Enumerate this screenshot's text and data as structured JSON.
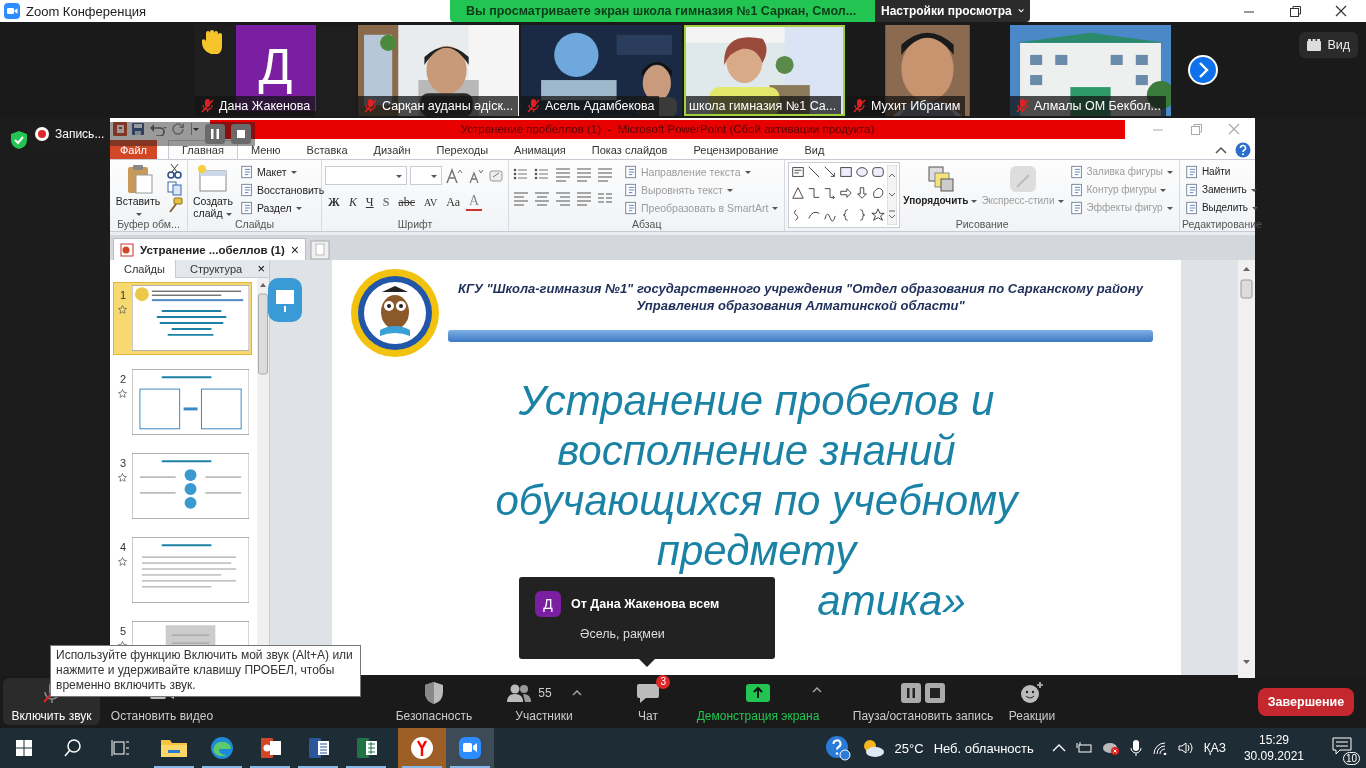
{
  "window": {
    "title": "Zoom Конференция"
  },
  "share_banner": {
    "text": "Вы просматриваете экран школа гимназия №1 Саркан, Смол..."
  },
  "view_options": {
    "label": "Настройки просмотра"
  },
  "participants": [
    {
      "name": "Дана Жакенова",
      "kind": "avatar",
      "initial": "Д",
      "muted": true,
      "hand_raised": true,
      "speaking": false
    },
    {
      "name": "Сарқан ауданы әдіск...",
      "kind": "picture",
      "muted": true,
      "hand_raised": false,
      "speaking": false
    },
    {
      "name": "Асель Адамбекова",
      "kind": "picture",
      "muted": true,
      "hand_raised": false,
      "speaking": false
    },
    {
      "name": "школа гимназия №1 Са...",
      "kind": "picture",
      "muted": false,
      "hand_raised": false,
      "speaking": true
    },
    {
      "name": "Мухит Ибрагим",
      "kind": "picture",
      "muted": true,
      "hand_raised": false,
      "speaking": false
    },
    {
      "name": "Алмалы ОМ Бекбол...",
      "kind": "picture",
      "muted": true,
      "hand_raised": false,
      "speaking": false
    }
  ],
  "view_button": {
    "label": "Вид"
  },
  "recording": {
    "label": "Запись..."
  },
  "powerpoint": {
    "title": "Устранение пробеллов (1)  -  Microsoft PowerPoint (Сбой активации продукта)",
    "tabs": [
      {
        "label": "Файл",
        "kind": "file",
        "selected": false
      },
      {
        "label": "Главная",
        "kind": "tab",
        "selected": true
      },
      {
        "label": "Меню",
        "kind": "tab",
        "selected": false
      },
      {
        "label": "Вставка",
        "kind": "tab",
        "selected": false
      },
      {
        "label": "Дизайн",
        "kind": "tab",
        "selected": false
      },
      {
        "label": "Переходы",
        "kind": "tab",
        "selected": false
      },
      {
        "label": "Анимация",
        "kind": "tab",
        "selected": false
      },
      {
        "label": "Показ слайдов",
        "kind": "tab",
        "selected": false
      },
      {
        "label": "Рецензирование",
        "kind": "tab",
        "selected": false
      },
      {
        "label": "Вид",
        "kind": "tab",
        "selected": false
      }
    ],
    "ribbon": [
      {
        "kind": "clipboard",
        "label": "Буфер обм...",
        "items": [
          {
            "kind": "large",
            "label": "Вставить",
            "dropdown": true,
            "disabled": false
          }
        ]
      },
      {
        "kind": "slides",
        "label": "Слайды",
        "items": [
          {
            "kind": "large",
            "label": "Создать слайд",
            "dropdown": true,
            "disabled": false
          },
          {
            "kind": "small",
            "label": "Макет",
            "dropdown": true,
            "disabled": false
          },
          {
            "kind": "small",
            "label": "Восстановить",
            "dropdown": false,
            "disabled": false
          },
          {
            "kind": "small",
            "label": "Раздел",
            "dropdown": true,
            "disabled": false
          }
        ]
      },
      {
        "kind": "font",
        "label": "Шрифт",
        "items": [
          {
            "kind": "bold",
            "label": "Ж"
          },
          {
            "kind": "italic",
            "label": "К"
          },
          {
            "kind": "underline",
            "label": "Ч"
          },
          {
            "kind": "shadow",
            "label": "S"
          },
          {
            "kind": "strike",
            "label": "abc"
          },
          {
            "kind": "spacing",
            "label": "AV"
          },
          {
            "kind": "case",
            "label": "Аа"
          },
          {
            "kind": "color",
            "label": "A"
          }
        ]
      },
      {
        "kind": "paragraph",
        "label": "Абзац",
        "items": [
          {
            "kind": "small",
            "label": "Направление текста",
            "dropdown": true,
            "disabled": true
          },
          {
            "kind": "small",
            "label": "Выровнять текст",
            "dropdown": true,
            "disabled": true
          },
          {
            "kind": "small",
            "label": "Преобразовать в SmartArt",
            "dropdown": true,
            "disabled": true
          }
        ]
      },
      {
        "kind": "drawing",
        "label": "Рисование",
        "items": [
          {
            "kind": "large",
            "label": "Упорядочить",
            "dropdown": true,
            "disabled": false
          },
          {
            "kind": "large",
            "label": "Экспресс-стили",
            "dropdown": true,
            "disabled": true
          },
          {
            "kind": "small",
            "label": "Заливка фигуры",
            "dropdown": true,
            "disabled": true
          },
          {
            "kind": "small",
            "label": "Контур фигуры",
            "dropdown": true,
            "disabled": true
          },
          {
            "kind": "small",
            "label": "Эффекты фигур",
            "dropdown": true,
            "disabled": true
          }
        ]
      },
      {
        "kind": "editing",
        "label": "Редактирование",
        "items": [
          {
            "kind": "small",
            "label": "Найти",
            "dropdown": false,
            "disabled": false
          },
          {
            "kind": "small",
            "label": "Заменить",
            "dropdown": true,
            "disabled": false
          },
          {
            "kind": "small",
            "label": "Выделить",
            "dropdown": true,
            "disabled": false
          }
        ]
      }
    ],
    "document_tab": {
      "label": "Устранение ...обеллов (1)",
      "close": "×"
    },
    "panel": {
      "tabs": [
        {
          "label": "Слайды",
          "selected": true
        },
        {
          "label": "Структура",
          "selected": false
        }
      ],
      "close": "×"
    },
    "slides": [
      {
        "number": "1",
        "selected": true
      },
      {
        "number": "2",
        "selected": false
      },
      {
        "number": "3",
        "selected": false
      },
      {
        "number": "4",
        "selected": false
      },
      {
        "number": "5",
        "selected": false
      }
    ],
    "slide": {
      "header_lines": [
        "КГУ \"Школа-гимназия №1\" государственного учреждения \"Отдел образования по Сарканскому району",
        "Управления образования Алматинской области\""
      ],
      "title_lines": [
        "Устранение пробелов и",
        "восполнение знаний",
        "обучающихся по учебному",
        "предмету",
        "атика»"
      ]
    }
  },
  "toolbar": [
    {
      "kind": "audio",
      "label": "Включить звук",
      "muted": true
    },
    {
      "kind": "video",
      "label": "Остановить видео"
    },
    {
      "kind": "security",
      "label": "Безопасность"
    },
    {
      "kind": "participants",
      "label": "Участники",
      "count": "55"
    },
    {
      "kind": "chat",
      "label": "Чат",
      "badge": "3"
    },
    {
      "kind": "share",
      "label": "Демонстрация экрана"
    },
    {
      "kind": "record",
      "label": "Пауза/остановить запись"
    },
    {
      "kind": "reactions",
      "label": "Реакции"
    }
  ],
  "end_button": {
    "label": "Завершение"
  },
  "tooltip": {
    "text": "Используйте функцию Включить мой звук (Alt+A) или нажмите и удерживайте клавишу ПРОБЕЛ, чтобы временно включить звук."
  },
  "chat_popup": {
    "initial": "Д",
    "header": "От Дана Жакенова всем",
    "message": "Әсель, рақмеи"
  },
  "taskbar": {
    "apps": [
      {
        "kind": "explorer",
        "active": false
      },
      {
        "kind": "edge",
        "active": false
      },
      {
        "kind": "powerpoint",
        "active": false
      },
      {
        "kind": "word",
        "active": false
      },
      {
        "kind": "excel",
        "active": false
      },
      {
        "kind": "yandex",
        "active": true
      },
      {
        "kind": "zoom",
        "active": true
      }
    ],
    "weather": {
      "temperature": "25°C",
      "condition": "Неб. облачность"
    },
    "language": "ҚАЗ",
    "time": "15:29",
    "date": "30.09.2021",
    "notifications": "10"
  }
}
